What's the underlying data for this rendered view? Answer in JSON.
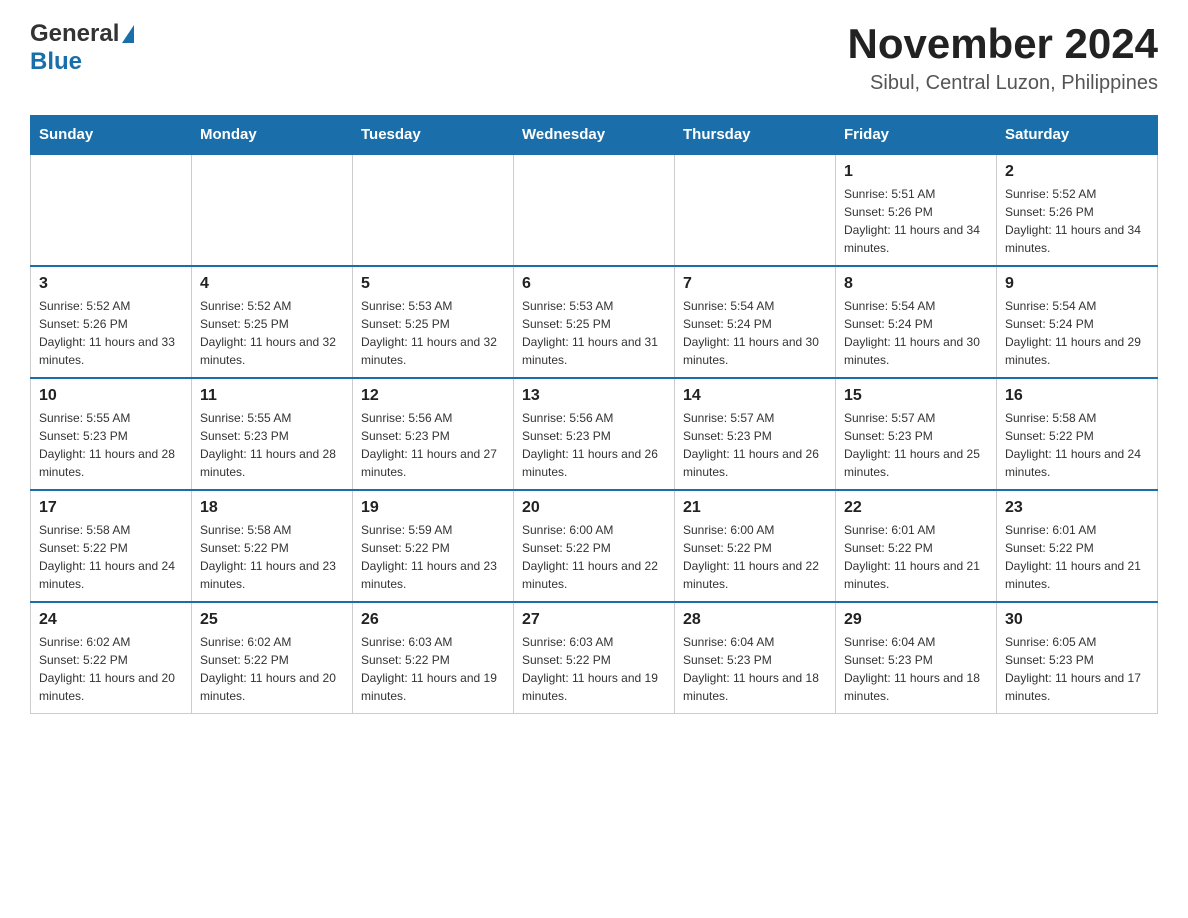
{
  "header": {
    "logo_general": "General",
    "logo_blue": "Blue",
    "title": "November 2024",
    "subtitle": "Sibul, Central Luzon, Philippines"
  },
  "days_of_week": [
    "Sunday",
    "Monday",
    "Tuesday",
    "Wednesday",
    "Thursday",
    "Friday",
    "Saturday"
  ],
  "weeks": [
    [
      {
        "day": "",
        "info": ""
      },
      {
        "day": "",
        "info": ""
      },
      {
        "day": "",
        "info": ""
      },
      {
        "day": "",
        "info": ""
      },
      {
        "day": "",
        "info": ""
      },
      {
        "day": "1",
        "info": "Sunrise: 5:51 AM\nSunset: 5:26 PM\nDaylight: 11 hours and 34 minutes."
      },
      {
        "day": "2",
        "info": "Sunrise: 5:52 AM\nSunset: 5:26 PM\nDaylight: 11 hours and 34 minutes."
      }
    ],
    [
      {
        "day": "3",
        "info": "Sunrise: 5:52 AM\nSunset: 5:26 PM\nDaylight: 11 hours and 33 minutes."
      },
      {
        "day": "4",
        "info": "Sunrise: 5:52 AM\nSunset: 5:25 PM\nDaylight: 11 hours and 32 minutes."
      },
      {
        "day": "5",
        "info": "Sunrise: 5:53 AM\nSunset: 5:25 PM\nDaylight: 11 hours and 32 minutes."
      },
      {
        "day": "6",
        "info": "Sunrise: 5:53 AM\nSunset: 5:25 PM\nDaylight: 11 hours and 31 minutes."
      },
      {
        "day": "7",
        "info": "Sunrise: 5:54 AM\nSunset: 5:24 PM\nDaylight: 11 hours and 30 minutes."
      },
      {
        "day": "8",
        "info": "Sunrise: 5:54 AM\nSunset: 5:24 PM\nDaylight: 11 hours and 30 minutes."
      },
      {
        "day": "9",
        "info": "Sunrise: 5:54 AM\nSunset: 5:24 PM\nDaylight: 11 hours and 29 minutes."
      }
    ],
    [
      {
        "day": "10",
        "info": "Sunrise: 5:55 AM\nSunset: 5:23 PM\nDaylight: 11 hours and 28 minutes."
      },
      {
        "day": "11",
        "info": "Sunrise: 5:55 AM\nSunset: 5:23 PM\nDaylight: 11 hours and 28 minutes."
      },
      {
        "day": "12",
        "info": "Sunrise: 5:56 AM\nSunset: 5:23 PM\nDaylight: 11 hours and 27 minutes."
      },
      {
        "day": "13",
        "info": "Sunrise: 5:56 AM\nSunset: 5:23 PM\nDaylight: 11 hours and 26 minutes."
      },
      {
        "day": "14",
        "info": "Sunrise: 5:57 AM\nSunset: 5:23 PM\nDaylight: 11 hours and 26 minutes."
      },
      {
        "day": "15",
        "info": "Sunrise: 5:57 AM\nSunset: 5:23 PM\nDaylight: 11 hours and 25 minutes."
      },
      {
        "day": "16",
        "info": "Sunrise: 5:58 AM\nSunset: 5:22 PM\nDaylight: 11 hours and 24 minutes."
      }
    ],
    [
      {
        "day": "17",
        "info": "Sunrise: 5:58 AM\nSunset: 5:22 PM\nDaylight: 11 hours and 24 minutes."
      },
      {
        "day": "18",
        "info": "Sunrise: 5:58 AM\nSunset: 5:22 PM\nDaylight: 11 hours and 23 minutes."
      },
      {
        "day": "19",
        "info": "Sunrise: 5:59 AM\nSunset: 5:22 PM\nDaylight: 11 hours and 23 minutes."
      },
      {
        "day": "20",
        "info": "Sunrise: 6:00 AM\nSunset: 5:22 PM\nDaylight: 11 hours and 22 minutes."
      },
      {
        "day": "21",
        "info": "Sunrise: 6:00 AM\nSunset: 5:22 PM\nDaylight: 11 hours and 22 minutes."
      },
      {
        "day": "22",
        "info": "Sunrise: 6:01 AM\nSunset: 5:22 PM\nDaylight: 11 hours and 21 minutes."
      },
      {
        "day": "23",
        "info": "Sunrise: 6:01 AM\nSunset: 5:22 PM\nDaylight: 11 hours and 21 minutes."
      }
    ],
    [
      {
        "day": "24",
        "info": "Sunrise: 6:02 AM\nSunset: 5:22 PM\nDaylight: 11 hours and 20 minutes."
      },
      {
        "day": "25",
        "info": "Sunrise: 6:02 AM\nSunset: 5:22 PM\nDaylight: 11 hours and 20 minutes."
      },
      {
        "day": "26",
        "info": "Sunrise: 6:03 AM\nSunset: 5:22 PM\nDaylight: 11 hours and 19 minutes."
      },
      {
        "day": "27",
        "info": "Sunrise: 6:03 AM\nSunset: 5:22 PM\nDaylight: 11 hours and 19 minutes."
      },
      {
        "day": "28",
        "info": "Sunrise: 6:04 AM\nSunset: 5:23 PM\nDaylight: 11 hours and 18 minutes."
      },
      {
        "day": "29",
        "info": "Sunrise: 6:04 AM\nSunset: 5:23 PM\nDaylight: 11 hours and 18 minutes."
      },
      {
        "day": "30",
        "info": "Sunrise: 6:05 AM\nSunset: 5:23 PM\nDaylight: 11 hours and 17 minutes."
      }
    ]
  ]
}
